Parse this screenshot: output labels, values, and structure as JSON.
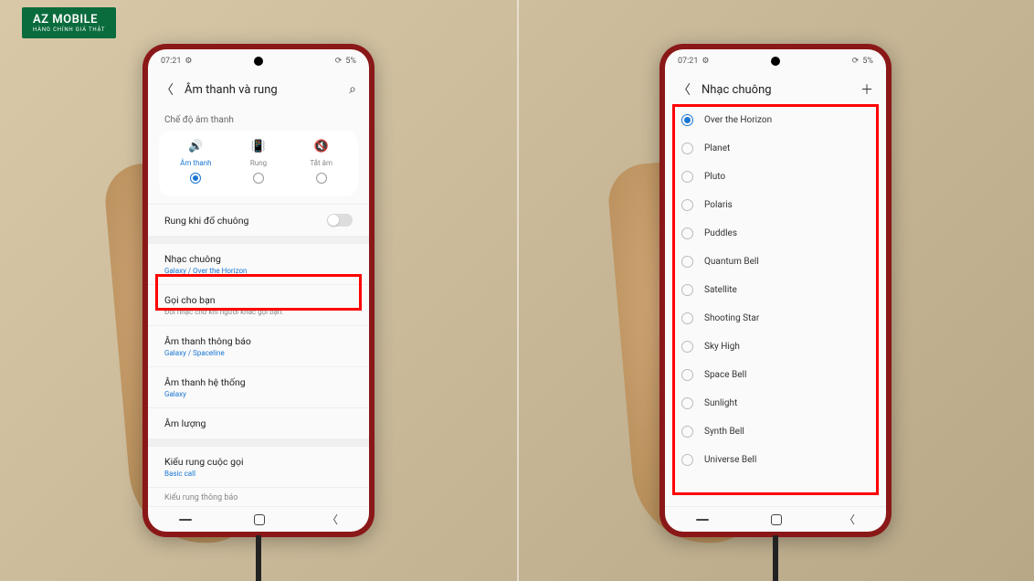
{
  "logo": {
    "main": "AZ MOBILE",
    "sub": "HÀNG CHÍNH GIÁ THẬT"
  },
  "status": {
    "time": "07:21",
    "battery": "5%"
  },
  "left_screen": {
    "title": "Âm thanh và rung",
    "section_mode": "Chế độ âm thanh",
    "modes": [
      {
        "label": "Âm thanh",
        "active": true
      },
      {
        "label": "Rung",
        "active": false
      },
      {
        "label": "Tắt âm",
        "active": false
      }
    ],
    "vibrate_ring": "Rung khi đổ chuông",
    "ringtone": {
      "label": "Nhạc chuông",
      "sub": "Galaxy / Over the Horizon"
    },
    "call_for_you": {
      "label": "Gọi cho bạn",
      "sub": "Đổi nhạc chờ khi người khác gọi bạn."
    },
    "notif_sound": {
      "label": "Âm thanh thông báo",
      "sub": "Galaxy / Spaceline"
    },
    "system_sound": {
      "label": "Âm thanh hệ thống",
      "sub": "Galaxy"
    },
    "volume": {
      "label": "Âm lượng"
    },
    "vib_pattern": {
      "label": "Kiểu rung cuộc gọi",
      "sub": "Basic call"
    },
    "notif_vib": "Kiểu rung thông báo"
  },
  "right_screen": {
    "title": "Nhạc chuông",
    "ringtones": [
      {
        "name": "Over the Horizon",
        "selected": true
      },
      {
        "name": "Planet",
        "selected": false
      },
      {
        "name": "Pluto",
        "selected": false
      },
      {
        "name": "Polaris",
        "selected": false
      },
      {
        "name": "Puddles",
        "selected": false
      },
      {
        "name": "Quantum Bell",
        "selected": false
      },
      {
        "name": "Satellite",
        "selected": false
      },
      {
        "name": "Shooting Star",
        "selected": false
      },
      {
        "name": "Sky High",
        "selected": false
      },
      {
        "name": "Space Bell",
        "selected": false
      },
      {
        "name": "Sunlight",
        "selected": false
      },
      {
        "name": "Synth Bell",
        "selected": false
      },
      {
        "name": "Universe Bell",
        "selected": false
      }
    ]
  }
}
